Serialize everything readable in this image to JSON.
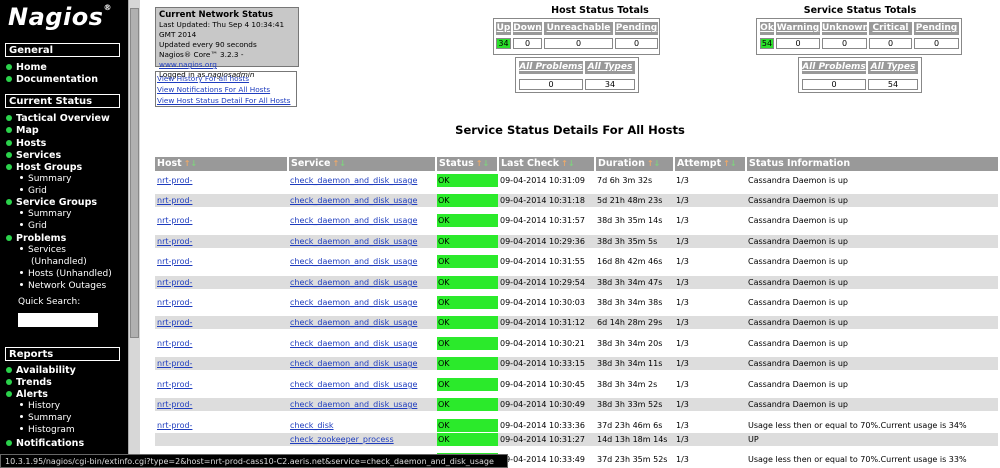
{
  "sidebar": {
    "logo": "Nagios",
    "logo_reg": "®",
    "general": {
      "head": "General",
      "items": [
        "Home",
        "Documentation"
      ]
    },
    "current_status": {
      "head": "Current Status",
      "items": [
        "Tactical Overview",
        "Map",
        "Hosts",
        "Services",
        "Host Groups",
        "Service Groups",
        "Problems"
      ],
      "host_groups_sub": [
        "Summary",
        "Grid"
      ],
      "service_groups_sub": [
        "Summary",
        "Grid"
      ],
      "problems_sub": [
        "Services",
        "(Unhandled)",
        "Hosts (Unhandled)",
        "Network Outages"
      ],
      "quick_search_label": "Quick Search:",
      "quick_search_value": ""
    },
    "reports": {
      "head": "Reports",
      "items": [
        "Availability",
        "Trends",
        "Alerts",
        "Notifications"
      ],
      "alerts_sub": [
        "History",
        "Summary",
        "Histogram"
      ]
    }
  },
  "network_status": {
    "title": "Current Network Status",
    "last_updated": "Last Updated: Thu Sep 4 10:34:41 GMT 2014",
    "update_interval": "Updated every 90 seconds",
    "core_prefix": "Nagios® Core™ 3.2.3 - ",
    "core_link": "www.nagios.org",
    "logged_in_prefix": "Logged in as ",
    "logged_in_user": "nagiosadmin",
    "links": [
      "View History For all hosts",
      "View Notifications For All Hosts",
      "View Host Status Detail For All Hosts"
    ]
  },
  "host_totals": {
    "title": "Host Status Totals",
    "headers": [
      "Up",
      "Down",
      "Unreachable",
      "Pending"
    ],
    "values": [
      "34",
      "0",
      "0",
      "0"
    ],
    "headers2": [
      "All Problems",
      "All Types"
    ],
    "values2": [
      "0",
      "34"
    ]
  },
  "service_totals": {
    "title": "Service Status Totals",
    "headers": [
      "Ok",
      "Warning",
      "Unknown",
      "Critical",
      "Pending"
    ],
    "values": [
      "54",
      "0",
      "0",
      "0",
      "0"
    ],
    "headers2": [
      "All Problems",
      "All Types"
    ],
    "values2": [
      "0",
      "54"
    ]
  },
  "service_details": {
    "title": "Service Status Details For All Hosts",
    "columns": [
      "Host",
      "Service",
      "Status",
      "Last Check",
      "Duration",
      "Attempt",
      "Status Information"
    ],
    "rows": [
      {
        "host": "nrt-prod-",
        "service": "check_daemon_and_disk_usage",
        "status": "OK",
        "last_check": "09-04-2014 10:31:09",
        "duration": "7d 6h 3m 32s",
        "attempt": "1/3",
        "info": "Cassandra Daemon is up"
      },
      {
        "host": "nrt-prod-",
        "service": "check_daemon_and_disk_usage",
        "status": "OK",
        "last_check": "09-04-2014 10:31:18",
        "duration": "5d 21h 48m 23s",
        "attempt": "1/3",
        "info": "Cassandra Daemon is up"
      },
      {
        "host": "nrt-prod-",
        "service": "check_daemon_and_disk_usage",
        "status": "OK",
        "last_check": "09-04-2014 10:31:57",
        "duration": "38d 3h 35m 14s",
        "attempt": "1/3",
        "info": "Cassandra Daemon is up"
      },
      {
        "host": "nrt-prod-",
        "service": "check_daemon_and_disk_usage",
        "status": "OK",
        "last_check": "09-04-2014 10:29:36",
        "duration": "38d 3h 35m 5s",
        "attempt": "1/3",
        "info": "Cassandra Daemon is up"
      },
      {
        "host": "nrt-prod-",
        "service": "check_daemon_and_disk_usage",
        "status": "OK",
        "last_check": "09-04-2014 10:31:55",
        "duration": "16d 8h 42m 46s",
        "attempt": "1/3",
        "info": "Cassandra Daemon is up"
      },
      {
        "host": "nrt-prod-",
        "service": "check_daemon_and_disk_usage",
        "status": "OK",
        "last_check": "09-04-2014 10:29:54",
        "duration": "38d 3h 34m 47s",
        "attempt": "1/3",
        "info": "Cassandra Daemon is up"
      },
      {
        "host": "nrt-prod-",
        "service": "check_daemon_and_disk_usage",
        "status": "OK",
        "last_check": "09-04-2014 10:30:03",
        "duration": "38d 3h 34m 38s",
        "attempt": "1/3",
        "info": "Cassandra Daemon is up"
      },
      {
        "host": "nrt-prod-",
        "service": "check_daemon_and_disk_usage",
        "status": "OK",
        "last_check": "09-04-2014 10:31:12",
        "duration": "6d 14h 28m 29s",
        "attempt": "1/3",
        "info": "Cassandra Daemon is up"
      },
      {
        "host": "nrt-prod-",
        "service": "check_daemon_and_disk_usage",
        "status": "OK",
        "last_check": "09-04-2014 10:30:21",
        "duration": "38d 3h 34m 20s",
        "attempt": "1/3",
        "info": "Cassandra Daemon is up"
      },
      {
        "host": "nrt-prod-",
        "service": "check_daemon_and_disk_usage",
        "status": "OK",
        "last_check": "09-04-2014 10:33:15",
        "duration": "38d 3h 34m 11s",
        "attempt": "1/3",
        "info": "Cassandra Daemon is up"
      },
      {
        "host": "nrt-prod-",
        "service": "check_daemon_and_disk_usage",
        "status": "OK",
        "last_check": "09-04-2014 10:30:45",
        "duration": "38d 3h 34m 2s",
        "attempt": "1/3",
        "info": "Cassandra Daemon is up"
      },
      {
        "host": "nrt-prod-",
        "service": "check_daemon_and_disk_usage",
        "status": "OK",
        "last_check": "09-04-2014 10:30:49",
        "duration": "38d 3h 33m 52s",
        "attempt": "1/3",
        "info": "Cassandra Daemon is up"
      },
      {
        "host": "nrt-prod-",
        "service": "check_disk",
        "status": "OK",
        "last_check": "09-04-2014 10:33:36",
        "duration": "37d 23h 46m 6s",
        "attempt": "1/3",
        "info": "Usage less then or equal to 70%.Current usage is 34%"
      },
      {
        "host": "",
        "service": "check_zookeeper_process",
        "status": "OK",
        "last_check": "09-04-2014 10:31:27",
        "duration": "14d 13h 18m 14s",
        "attempt": "1/3",
        "info": "UP"
      },
      {
        "host": "",
        "service": "",
        "status": "OK",
        "last_check": "09-04-2014 10:33:49",
        "duration": "37d 23h 35m 52s",
        "attempt": "1/3",
        "info": "Usage less then or equal to 70%.Current usage is 33%"
      }
    ]
  },
  "status_bar": {
    "url": "10.3.1.95/nagios/cgi-bin/extinfo.cgi?type=2&host=nrt-prod-cass10-C2.aeris.net&service=check_daemon_and_disk_usage"
  },
  "colors": {
    "ok_green": "#2bea2b",
    "header_gray": "#999999",
    "row_alt": "#dddddd",
    "sidebar_bg": "#000000",
    "link_blue": "#1e3cbe"
  }
}
